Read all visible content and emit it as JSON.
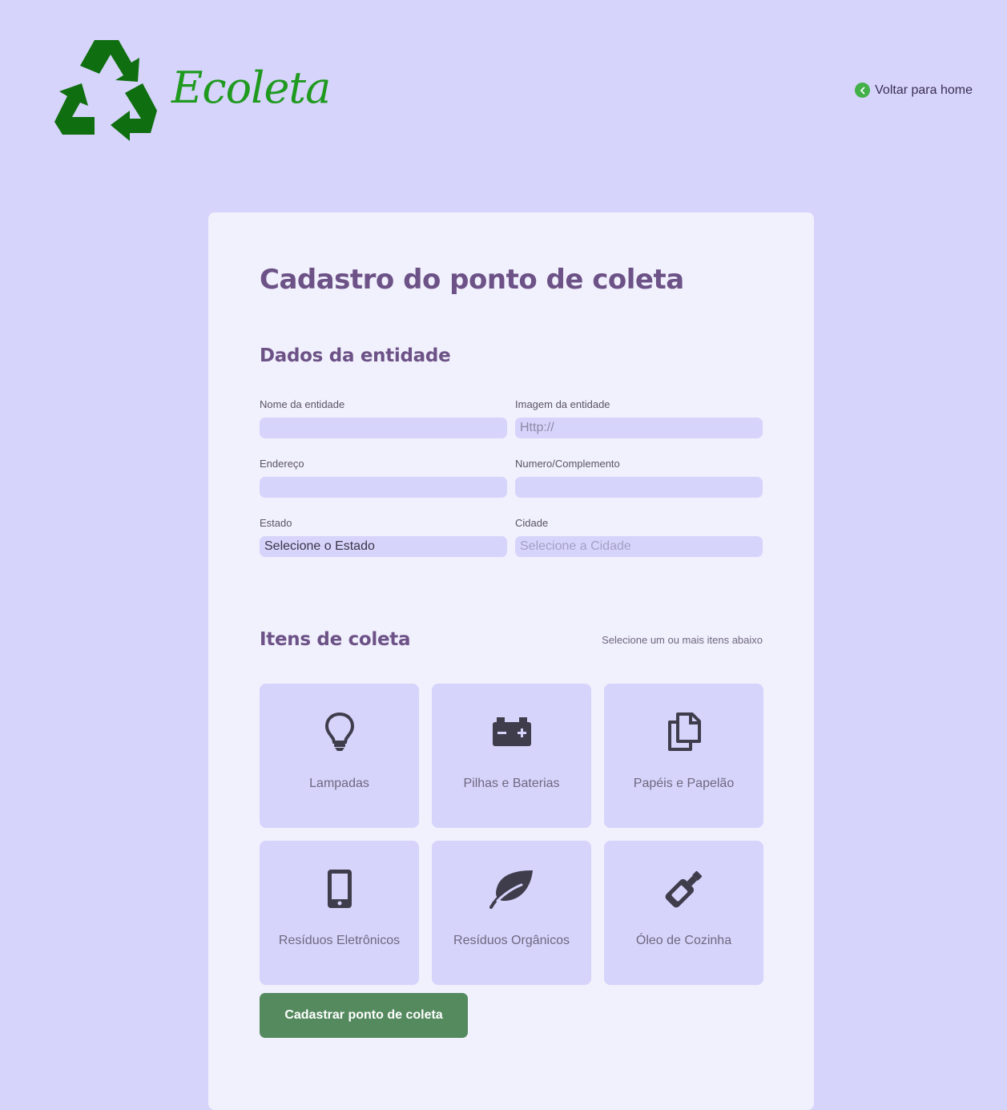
{
  "header": {
    "brand": "Ecoleta",
    "brand_color": "#1f9a1f",
    "logo_icon": "recycle-icon",
    "back_label": "Voltar para home",
    "back_icon": "chevron-left-icon"
  },
  "form": {
    "title": "Cadastro do ponto de coleta",
    "entity_section": "Dados da entidade",
    "fields": {
      "name": {
        "label": "Nome da entidade",
        "value": ""
      },
      "image": {
        "label": "Imagem da entidade",
        "placeholder": "Http://"
      },
      "address": {
        "label": "Endereço",
        "value": ""
      },
      "number": {
        "label": "Numero/Complemento",
        "value": ""
      },
      "state": {
        "label": "Estado",
        "selected": "Selecione o Estado"
      },
      "city": {
        "label": "Cidade",
        "selected": "Selecione a Cidade"
      }
    },
    "items_section": "Itens de coleta",
    "items_hint": "Selecione um ou mais itens abaixo",
    "items": [
      {
        "label": "Lampadas",
        "icon": "lightbulb-icon"
      },
      {
        "label": "Pilhas e Baterias",
        "icon": "battery-icon"
      },
      {
        "label": "Papéis e Papelão",
        "icon": "paper-icon"
      },
      {
        "label": "Resíduos Eletrônicos",
        "icon": "phone-icon"
      },
      {
        "label": "Resíduos Orgânicos",
        "icon": "leaf-icon"
      },
      {
        "label": "Óleo de Cozinha",
        "icon": "oil-bottle-icon"
      }
    ],
    "submit_label": "Cadastrar ponto de coleta",
    "accent_color": "#6c5286",
    "button_color": "#558a5f"
  }
}
